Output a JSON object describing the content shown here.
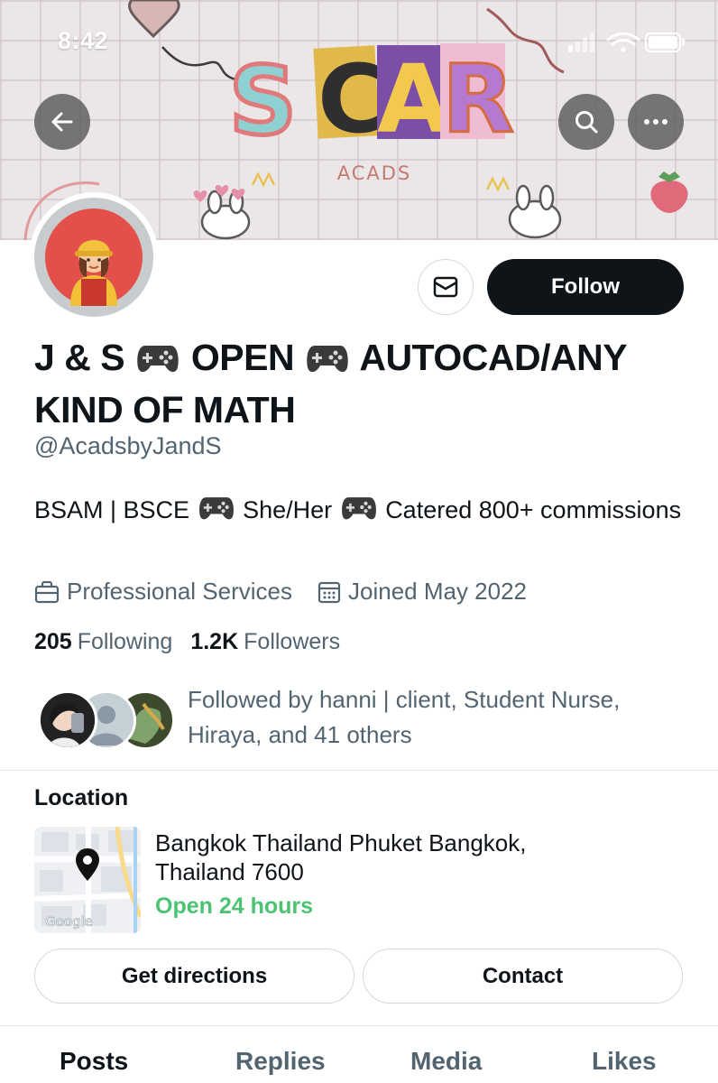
{
  "status_bar": {
    "time": "8:42"
  },
  "banner": {
    "title": "SCAR",
    "subtitle": "ACADS"
  },
  "actions": {
    "follow_label": "Follow"
  },
  "profile": {
    "name_parts": [
      "J & S",
      "OPEN",
      "AUTOCAD/ANY KIND OF MATH"
    ],
    "handle": "@AcadsbyJandS",
    "bio_parts": [
      "BSAM | BSCE",
      "She/Her",
      "Catered 800+ commissions"
    ],
    "category": "Professional Services",
    "joined": "Joined May 2022",
    "following_count": "205",
    "following_label": "Following",
    "followers_count": "1.2K",
    "followers_label": "Followers",
    "followed_by": "Followed by hanni | client, Student Nurse, Hiraya, and 41 others"
  },
  "location": {
    "title": "Location",
    "address": "Bangkok Thailand Phuket Bangkok, Thailand 7600",
    "hours": "Open 24 hours",
    "map_label": "Google",
    "directions_label": "Get directions",
    "contact_label": "Contact"
  },
  "tabs": [
    {
      "label": "Posts",
      "active": true
    },
    {
      "label": "Replies",
      "active": false
    },
    {
      "label": "Media",
      "active": false
    },
    {
      "label": "Likes",
      "active": false
    }
  ],
  "colors": {
    "accent_black": "#0f1419",
    "secondary_text": "#536471",
    "open_green": "#4cc373",
    "avatar_bg": "#e3504a"
  },
  "icons": {
    "back": "arrow-left-icon",
    "search": "search-icon",
    "more": "more-icon",
    "message": "envelope-icon",
    "category": "briefcase-icon",
    "joined": "calendar-icon",
    "map_pin": "map-pin-icon",
    "emoji": "game-controller-icon"
  }
}
